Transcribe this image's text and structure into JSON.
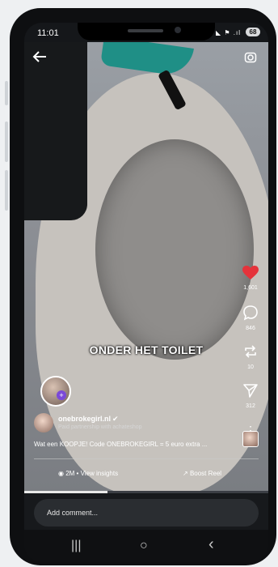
{
  "status_bar": {
    "time": "11:01",
    "icons": "◣ ⚑ .ıl",
    "battery": "68"
  },
  "video": {
    "caption": "ONDER HET TOILET",
    "back_icon": "back-arrow-icon",
    "camera_icon": "camera-icon"
  },
  "actions": {
    "likes": "1,601",
    "comments": "846",
    "reposts": "10",
    "shares": "312",
    "like_color": "#e5333b"
  },
  "author": {
    "username": "onebrokegirl.nl",
    "partnership": "Paid partnership with achateshop",
    "description": "Wat een KOOPJE! Code ONEBROKEGIRL = 5 euro extra ..."
  },
  "insights": {
    "views": "2M • View insights",
    "boost": "Boost Reel"
  },
  "playback": {
    "progress": 0.34
  },
  "comment": {
    "placeholder": "Add comment..."
  },
  "nav": {
    "recents": "|||",
    "home": "○",
    "back": "‹"
  }
}
